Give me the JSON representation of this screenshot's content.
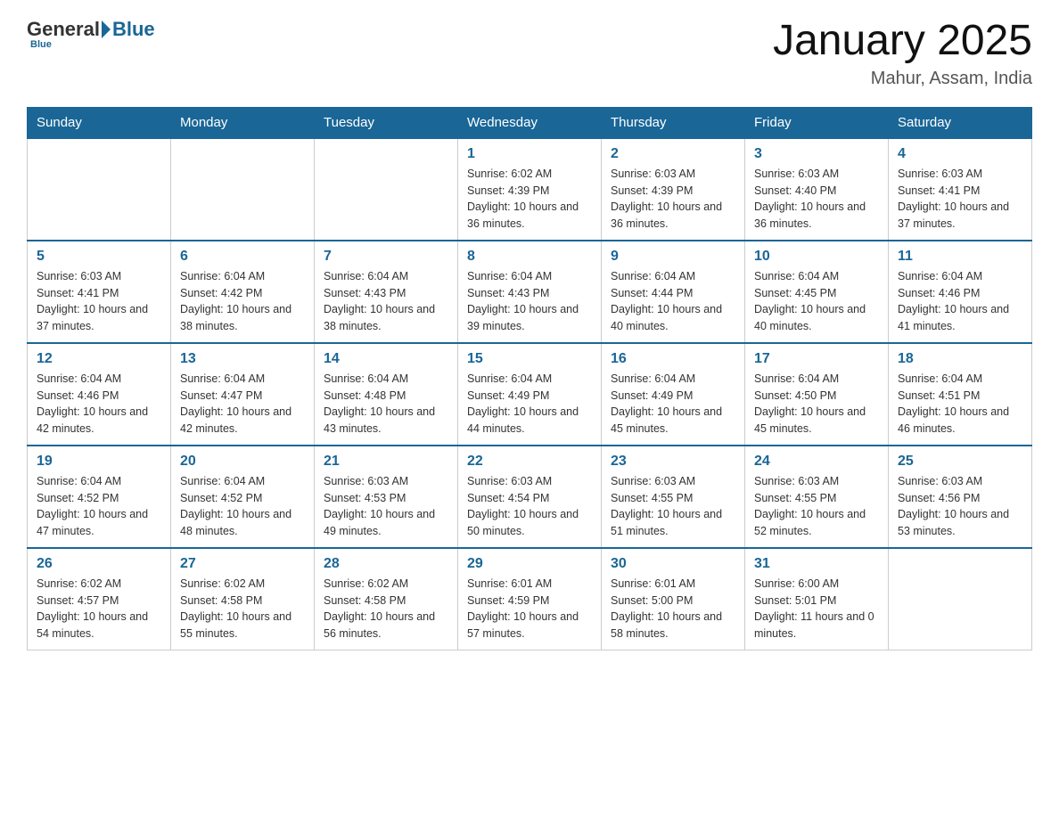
{
  "header": {
    "title": "January 2025",
    "location": "Mahur, Assam, India",
    "logo_general": "General",
    "logo_blue": "Blue"
  },
  "days_of_week": [
    "Sunday",
    "Monday",
    "Tuesday",
    "Wednesday",
    "Thursday",
    "Friday",
    "Saturday"
  ],
  "weeks": [
    [
      {
        "day": "",
        "sunrise": "",
        "sunset": "",
        "daylight": ""
      },
      {
        "day": "",
        "sunrise": "",
        "sunset": "",
        "daylight": ""
      },
      {
        "day": "",
        "sunrise": "",
        "sunset": "",
        "daylight": ""
      },
      {
        "day": "1",
        "sunrise": "Sunrise: 6:02 AM",
        "sunset": "Sunset: 4:39 PM",
        "daylight": "Daylight: 10 hours and 36 minutes."
      },
      {
        "day": "2",
        "sunrise": "Sunrise: 6:03 AM",
        "sunset": "Sunset: 4:39 PM",
        "daylight": "Daylight: 10 hours and 36 minutes."
      },
      {
        "day": "3",
        "sunrise": "Sunrise: 6:03 AM",
        "sunset": "Sunset: 4:40 PM",
        "daylight": "Daylight: 10 hours and 36 minutes."
      },
      {
        "day": "4",
        "sunrise": "Sunrise: 6:03 AM",
        "sunset": "Sunset: 4:41 PM",
        "daylight": "Daylight: 10 hours and 37 minutes."
      }
    ],
    [
      {
        "day": "5",
        "sunrise": "Sunrise: 6:03 AM",
        "sunset": "Sunset: 4:41 PM",
        "daylight": "Daylight: 10 hours and 37 minutes."
      },
      {
        "day": "6",
        "sunrise": "Sunrise: 6:04 AM",
        "sunset": "Sunset: 4:42 PM",
        "daylight": "Daylight: 10 hours and 38 minutes."
      },
      {
        "day": "7",
        "sunrise": "Sunrise: 6:04 AM",
        "sunset": "Sunset: 4:43 PM",
        "daylight": "Daylight: 10 hours and 38 minutes."
      },
      {
        "day": "8",
        "sunrise": "Sunrise: 6:04 AM",
        "sunset": "Sunset: 4:43 PM",
        "daylight": "Daylight: 10 hours and 39 minutes."
      },
      {
        "day": "9",
        "sunrise": "Sunrise: 6:04 AM",
        "sunset": "Sunset: 4:44 PM",
        "daylight": "Daylight: 10 hours and 40 minutes."
      },
      {
        "day": "10",
        "sunrise": "Sunrise: 6:04 AM",
        "sunset": "Sunset: 4:45 PM",
        "daylight": "Daylight: 10 hours and 40 minutes."
      },
      {
        "day": "11",
        "sunrise": "Sunrise: 6:04 AM",
        "sunset": "Sunset: 4:46 PM",
        "daylight": "Daylight: 10 hours and 41 minutes."
      }
    ],
    [
      {
        "day": "12",
        "sunrise": "Sunrise: 6:04 AM",
        "sunset": "Sunset: 4:46 PM",
        "daylight": "Daylight: 10 hours and 42 minutes."
      },
      {
        "day": "13",
        "sunrise": "Sunrise: 6:04 AM",
        "sunset": "Sunset: 4:47 PM",
        "daylight": "Daylight: 10 hours and 42 minutes."
      },
      {
        "day": "14",
        "sunrise": "Sunrise: 6:04 AM",
        "sunset": "Sunset: 4:48 PM",
        "daylight": "Daylight: 10 hours and 43 minutes."
      },
      {
        "day": "15",
        "sunrise": "Sunrise: 6:04 AM",
        "sunset": "Sunset: 4:49 PM",
        "daylight": "Daylight: 10 hours and 44 minutes."
      },
      {
        "day": "16",
        "sunrise": "Sunrise: 6:04 AM",
        "sunset": "Sunset: 4:49 PM",
        "daylight": "Daylight: 10 hours and 45 minutes."
      },
      {
        "day": "17",
        "sunrise": "Sunrise: 6:04 AM",
        "sunset": "Sunset: 4:50 PM",
        "daylight": "Daylight: 10 hours and 45 minutes."
      },
      {
        "day": "18",
        "sunrise": "Sunrise: 6:04 AM",
        "sunset": "Sunset: 4:51 PM",
        "daylight": "Daylight: 10 hours and 46 minutes."
      }
    ],
    [
      {
        "day": "19",
        "sunrise": "Sunrise: 6:04 AM",
        "sunset": "Sunset: 4:52 PM",
        "daylight": "Daylight: 10 hours and 47 minutes."
      },
      {
        "day": "20",
        "sunrise": "Sunrise: 6:04 AM",
        "sunset": "Sunset: 4:52 PM",
        "daylight": "Daylight: 10 hours and 48 minutes."
      },
      {
        "day": "21",
        "sunrise": "Sunrise: 6:03 AM",
        "sunset": "Sunset: 4:53 PM",
        "daylight": "Daylight: 10 hours and 49 minutes."
      },
      {
        "day": "22",
        "sunrise": "Sunrise: 6:03 AM",
        "sunset": "Sunset: 4:54 PM",
        "daylight": "Daylight: 10 hours and 50 minutes."
      },
      {
        "day": "23",
        "sunrise": "Sunrise: 6:03 AM",
        "sunset": "Sunset: 4:55 PM",
        "daylight": "Daylight: 10 hours and 51 minutes."
      },
      {
        "day": "24",
        "sunrise": "Sunrise: 6:03 AM",
        "sunset": "Sunset: 4:55 PM",
        "daylight": "Daylight: 10 hours and 52 minutes."
      },
      {
        "day": "25",
        "sunrise": "Sunrise: 6:03 AM",
        "sunset": "Sunset: 4:56 PM",
        "daylight": "Daylight: 10 hours and 53 minutes."
      }
    ],
    [
      {
        "day": "26",
        "sunrise": "Sunrise: 6:02 AM",
        "sunset": "Sunset: 4:57 PM",
        "daylight": "Daylight: 10 hours and 54 minutes."
      },
      {
        "day": "27",
        "sunrise": "Sunrise: 6:02 AM",
        "sunset": "Sunset: 4:58 PM",
        "daylight": "Daylight: 10 hours and 55 minutes."
      },
      {
        "day": "28",
        "sunrise": "Sunrise: 6:02 AM",
        "sunset": "Sunset: 4:58 PM",
        "daylight": "Daylight: 10 hours and 56 minutes."
      },
      {
        "day": "29",
        "sunrise": "Sunrise: 6:01 AM",
        "sunset": "Sunset: 4:59 PM",
        "daylight": "Daylight: 10 hours and 57 minutes."
      },
      {
        "day": "30",
        "sunrise": "Sunrise: 6:01 AM",
        "sunset": "Sunset: 5:00 PM",
        "daylight": "Daylight: 10 hours and 58 minutes."
      },
      {
        "day": "31",
        "sunrise": "Sunrise: 6:00 AM",
        "sunset": "Sunset: 5:01 PM",
        "daylight": "Daylight: 11 hours and 0 minutes."
      },
      {
        "day": "",
        "sunrise": "",
        "sunset": "",
        "daylight": ""
      }
    ]
  ]
}
